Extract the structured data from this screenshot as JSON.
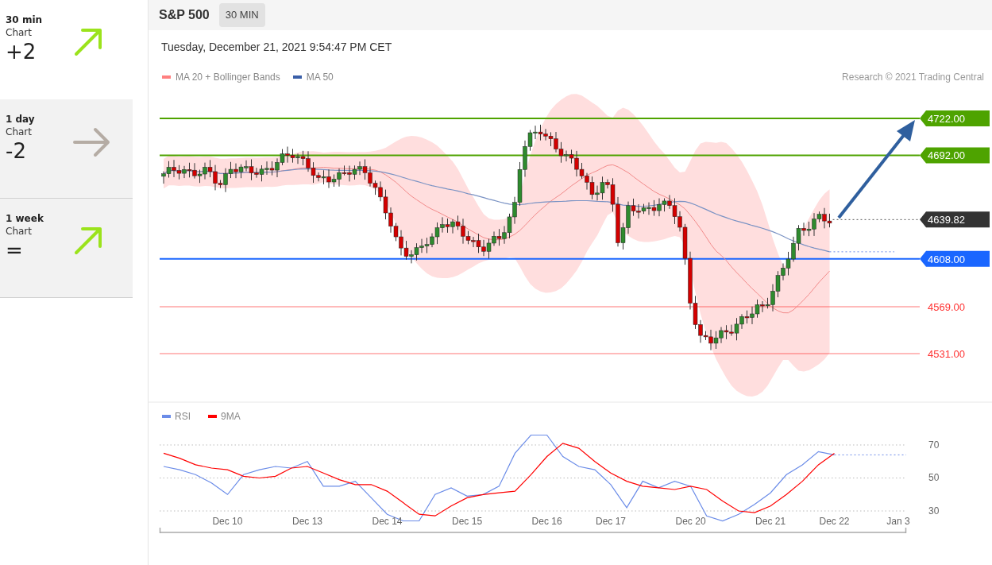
{
  "sidebar": {
    "items": [
      {
        "period": "30 min",
        "label": "Chart",
        "score": "+2",
        "kind": "up",
        "selected": true
      },
      {
        "period": "1 day",
        "label": "Chart",
        "score": "-2",
        "kind": "flat",
        "selected": false
      },
      {
        "period": "1 week",
        "label": "Chart",
        "score": "=",
        "kind": "up",
        "selected": false
      }
    ]
  },
  "header": {
    "title": "S&P 500",
    "timeframe": "30 MIN"
  },
  "timestamp": "Tuesday, December 21, 2021 9:54:47 PM CET",
  "legend": [
    {
      "label": "MA 20 + Bollinger Bands",
      "color": "#ff8080"
    },
    {
      "label": "MA 50",
      "color": "#3a5fa8"
    }
  ],
  "copyright": "Research © 2021 Trading Central",
  "levels": [
    {
      "label": "4722.00",
      "kind": "tag",
      "color": "#4ea300"
    },
    {
      "label": "4692.00",
      "kind": "tag",
      "color": "#4ea300"
    },
    {
      "label": "4639.82",
      "kind": "current",
      "color": "#333333"
    },
    {
      "label": "4608.00",
      "kind": "tag",
      "color": "#1a66ff"
    },
    {
      "label": "4569.00",
      "kind": "text",
      "color": "#ff3333"
    },
    {
      "label": "4531.00",
      "kind": "text",
      "color": "#ff3333"
    }
  ],
  "rsi": {
    "chart_data": {
      "type": "line",
      "categories": [
        null,
        null,
        null,
        null,
        "Dec 10",
        null,
        null,
        null,
        null,
        "Dec 13",
        null,
        null,
        null,
        null,
        "Dec 14",
        null,
        null,
        null,
        null,
        "Dec 15",
        null,
        null,
        null,
        null,
        "Dec 16",
        null,
        null,
        null,
        "Dec 17",
        null,
        null,
        null,
        null,
        "Dec 20",
        null,
        null,
        null,
        null,
        "Dec 21",
        null,
        null,
        null,
        "Dec 22",
        null,
        null,
        null,
        "Jan 3"
      ],
      "series": [
        {
          "name": "RSI",
          "color": "#6b8ce8",
          "values": [
            57,
            55,
            52,
            47,
            40,
            52,
            55,
            57,
            56,
            60,
            45,
            45,
            48,
            38,
            28,
            24,
            24,
            40,
            44,
            39,
            40,
            45,
            65,
            76,
            76,
            63,
            57,
            55,
            46,
            32,
            48,
            44,
            48,
            45,
            27,
            24,
            28,
            34,
            41,
            52,
            58,
            66,
            64,
            null,
            null,
            null,
            null
          ]
        },
        {
          "name": "9MA",
          "color": "#ff0000",
          "values": [
            65,
            62,
            58,
            56,
            55,
            51,
            50,
            51,
            56,
            57,
            53,
            49,
            46,
            46,
            42,
            35,
            28,
            27,
            33,
            38,
            40,
            41,
            42,
            52,
            63,
            71,
            68,
            60,
            53,
            48,
            45,
            44,
            43,
            45,
            43,
            36,
            30,
            29,
            33,
            40,
            48,
            58,
            65,
            null,
            null,
            null,
            null
          ]
        }
      ],
      "legend": "upper left",
      "ylim": [
        17,
        96
      ],
      "yticks": [
        30,
        50,
        70
      ],
      "grid": true
    }
  }
}
